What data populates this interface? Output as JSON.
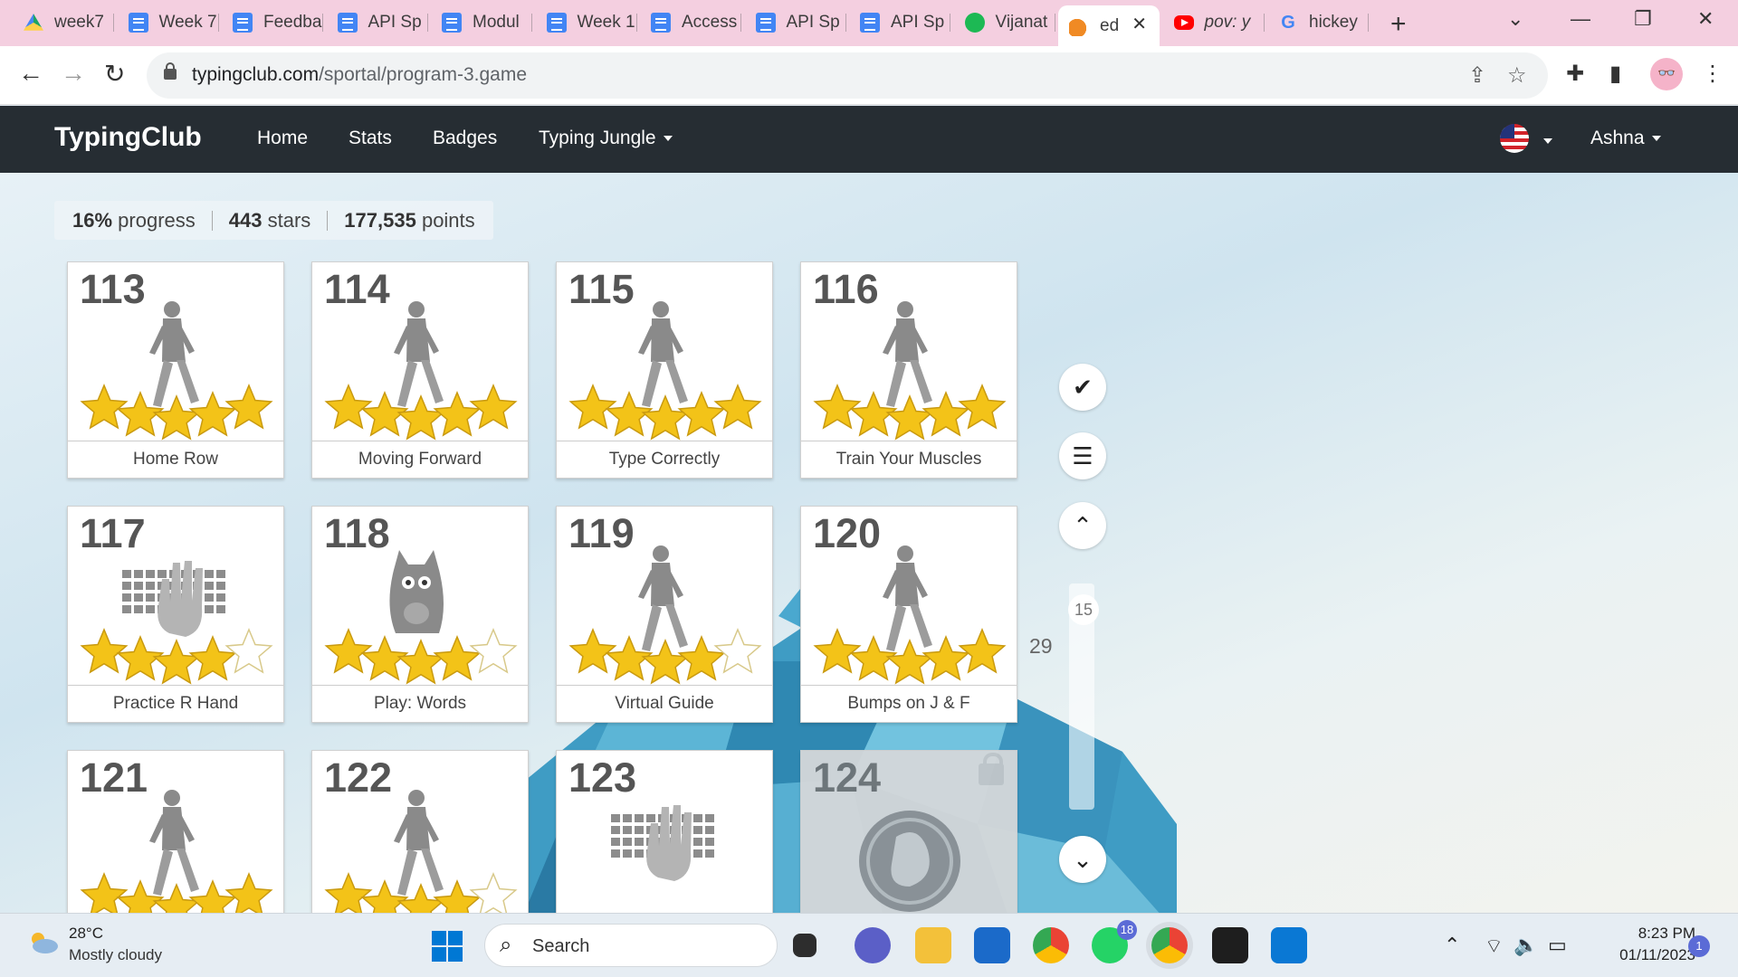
{
  "browser": {
    "tabs": [
      {
        "label": "week7",
        "icon": "drive-icon"
      },
      {
        "label": "Week 7",
        "icon": "docs-icon"
      },
      {
        "label": "Feedba",
        "icon": "docs-icon"
      },
      {
        "label": "API Sp",
        "icon": "docs-icon"
      },
      {
        "label": "Modul",
        "icon": "docs-icon"
      },
      {
        "label": "Week 1",
        "icon": "docs-icon"
      },
      {
        "label": "Access",
        "icon": "docs-icon"
      },
      {
        "label": "API Sp",
        "icon": "docs-icon"
      },
      {
        "label": "API Sp",
        "icon": "docs-icon"
      },
      {
        "label": "Vijanat",
        "icon": "spotify-icon"
      },
      {
        "label": "ed",
        "icon": "typingclub-icon",
        "active": true
      },
      {
        "label": "pov: y",
        "icon": "youtube-icon"
      },
      {
        "label": "hickey",
        "icon": "google-icon"
      }
    ],
    "url_host": "typingclub.com",
    "url_path": "/sportal/program-3.game"
  },
  "site": {
    "brand": "TypingClub",
    "nav": [
      "Home",
      "Stats",
      "Badges",
      "Typing Jungle"
    ],
    "user": "Ashna"
  },
  "stats": {
    "progress_value": "16%",
    "progress_label": "progress",
    "stars_value": "443",
    "stars_label": "stars",
    "points_value": "177,535",
    "points_label": "points"
  },
  "lessons": [
    {
      "num": "113",
      "title": "Home Row",
      "art": "walker",
      "stars": 5
    },
    {
      "num": "114",
      "title": "Moving Forward",
      "art": "walker",
      "stars": 5
    },
    {
      "num": "115",
      "title": "Type Correctly",
      "art": "walker",
      "stars": 5
    },
    {
      "num": "116",
      "title": "Train Your Muscles",
      "art": "walker",
      "stars": 5
    },
    {
      "num": "117",
      "title": "Practice R Hand",
      "art": "keyboard",
      "stars": 4
    },
    {
      "num": "118",
      "title": "Play: Words",
      "art": "monster",
      "stars": 4
    },
    {
      "num": "119",
      "title": "Virtual Guide",
      "art": "walker",
      "stars": 4
    },
    {
      "num": "120",
      "title": "Bumps on J & F",
      "art": "walker",
      "stars": 5
    },
    {
      "num": "121",
      "title": "",
      "art": "walker",
      "stars": 5
    },
    {
      "num": "122",
      "title": "",
      "art": "walker",
      "stars": 4
    },
    {
      "num": "123",
      "title": "",
      "art": "keyboard",
      "stars": 0
    },
    {
      "num": "124",
      "title": "",
      "art": "locked",
      "stars": 0
    }
  ],
  "scroller": {
    "marker": "15",
    "count": "29"
  },
  "taskbar": {
    "weather_temp": "28°C",
    "weather_desc": "Mostly cloudy",
    "search_label": "Search",
    "whatsapp_badge": "18",
    "time": "8:23 PM",
    "date": "01/11/2023",
    "notifications": "1"
  },
  "colors": {
    "nav_bg": "#262d33",
    "star": "#f3c318",
    "accent": "#0078d4"
  }
}
